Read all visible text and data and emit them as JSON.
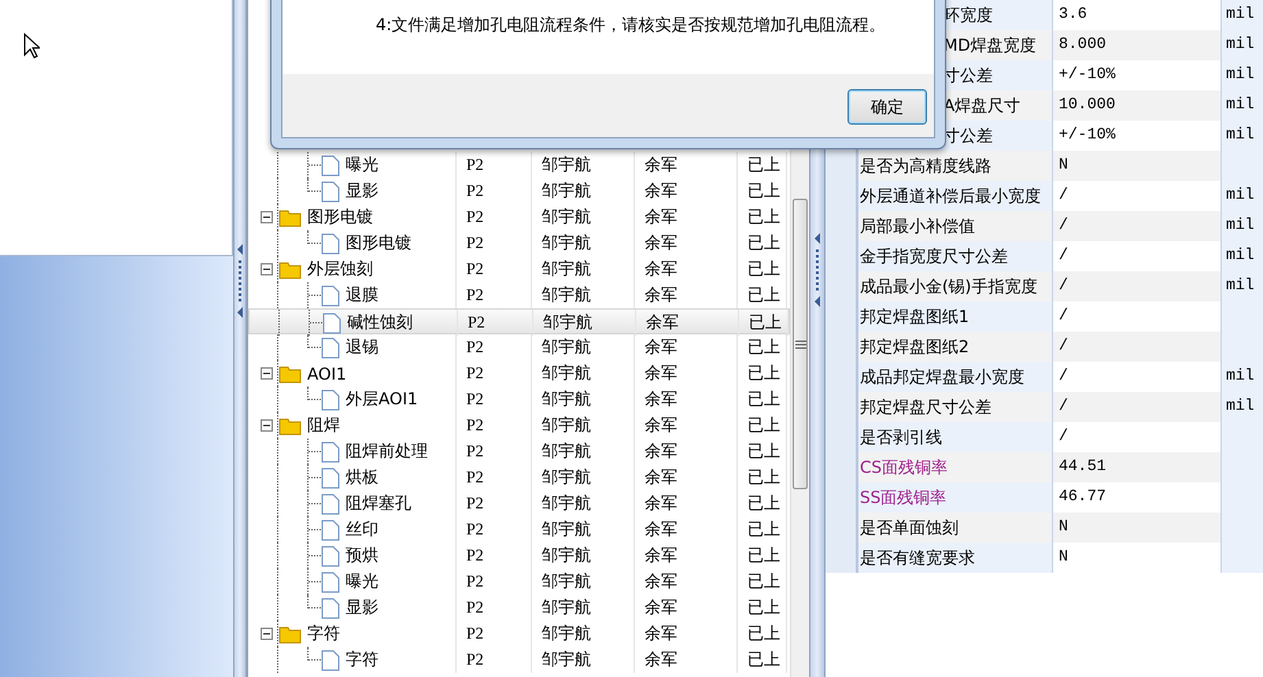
{
  "dialog": {
    "message": "4:文件满足增加孔电阻流程条件，请核实是否按规范增加孔电阻流程。",
    "ok_button": "确定"
  },
  "tree_grid": {
    "rows": [
      {
        "children": [
          {
            "name": "曝光",
            "c2": "P2",
            "c3": "邹宇航",
            "c4": "余军",
            "c5": "已上",
            "selected": false
          },
          {
            "name": "显影",
            "c2": "P2",
            "c3": "邹宇航",
            "c4": "余军",
            "c5": "已上",
            "selected": false
          }
        ]
      },
      {
        "name": "图形电镀",
        "c2": "P2",
        "c3": "邹宇航",
        "c4": "余军",
        "c5": "已上",
        "expanded": true,
        "selected": false,
        "children": [
          {
            "name": "图形电镀",
            "c2": "P2",
            "c3": "邹宇航",
            "c4": "余军",
            "c5": "已上",
            "selected": false
          }
        ]
      },
      {
        "name": "外层蚀刻",
        "c2": "P2",
        "c3": "邹宇航",
        "c4": "余军",
        "c5": "已上",
        "expanded": true,
        "selected": false,
        "children": [
          {
            "name": "退膜",
            "c2": "P2",
            "c3": "邹宇航",
            "c4": "余军",
            "c5": "已上",
            "selected": false
          },
          {
            "name": "碱性蚀刻",
            "c2": "P2",
            "c3": "邹宇航",
            "c4": "余军",
            "c5": "已上",
            "selected": true
          },
          {
            "name": "退锡",
            "c2": "P2",
            "c3": "邹宇航",
            "c4": "余军",
            "c5": "已上",
            "selected": false
          }
        ]
      },
      {
        "name": "AOI1",
        "c2": "P2",
        "c3": "邹宇航",
        "c4": "余军",
        "c5": "已上",
        "expanded": true,
        "selected": false,
        "children": [
          {
            "name": "外层AOI1",
            "c2": "P2",
            "c3": "邹宇航",
            "c4": "余军",
            "c5": "已上",
            "selected": false
          }
        ]
      },
      {
        "name": "阻焊",
        "c2": "P2",
        "c3": "邹宇航",
        "c4": "余军",
        "c5": "已上",
        "expanded": true,
        "selected": false,
        "children": [
          {
            "name": "阻焊前处理",
            "c2": "P2",
            "c3": "邹宇航",
            "c4": "余军",
            "c5": "已上",
            "selected": false
          },
          {
            "name": "烘板",
            "c2": "P2",
            "c3": "邹宇航",
            "c4": "余军",
            "c5": "已上",
            "selected": false
          },
          {
            "name": "阻焊塞孔",
            "c2": "P2",
            "c3": "邹宇航",
            "c4": "余军",
            "c5": "已上",
            "selected": false
          },
          {
            "name": "丝印",
            "c2": "P2",
            "c3": "邹宇航",
            "c4": "余军",
            "c5": "已上",
            "selected": false
          },
          {
            "name": "预烘",
            "c2": "P2",
            "c3": "邹宇航",
            "c4": "余军",
            "c5": "已上",
            "selected": false
          },
          {
            "name": "曝光",
            "c2": "P2",
            "c3": "邹宇航",
            "c4": "余军",
            "c5": "已上",
            "selected": false
          },
          {
            "name": "显影",
            "c2": "P2",
            "c3": "邹宇航",
            "c4": "余军",
            "c5": "已上",
            "selected": false
          }
        ]
      },
      {
        "name": "字符",
        "c2": "P2",
        "c3": "邹宇航",
        "c4": "余军",
        "c5": "已上",
        "expanded": true,
        "selected": false,
        "children": [
          {
            "name": "字符",
            "c2": "P2",
            "c3": "邹宇航",
            "c4": "余军",
            "c5": "已上",
            "selected": false
          }
        ]
      }
    ]
  },
  "property_grid": {
    "rows": [
      {
        "name": "环宽度",
        "value": "3.6",
        "unit": "mil",
        "under_dialog": true
      },
      {
        "name": "MD焊盘宽度",
        "value": "8.000",
        "unit": "mil",
        "under_dialog": true
      },
      {
        "name": "寸公差",
        "value": "+/-10%",
        "unit": "mil",
        "under_dialog": true
      },
      {
        "name": "A焊盘尺寸",
        "value": "10.000",
        "unit": "mil",
        "under_dialog": true
      },
      {
        "name": "寸公差",
        "value": "+/-10%",
        "unit": "mil",
        "under_dialog": true
      },
      {
        "name": "是否为高精度线路",
        "value": "N"
      },
      {
        "name": "外层通道补偿后最小宽度",
        "value": "/",
        "unit": "mil"
      },
      {
        "name": "局部最小补偿值",
        "value": "/",
        "unit": "mil"
      },
      {
        "name": "金手指宽度尺寸公差",
        "value": "/",
        "unit": "mil"
      },
      {
        "name": "成品最小金(锡)手指宽度",
        "value": "/",
        "unit": "mil"
      },
      {
        "name": "邦定焊盘图纸1",
        "value": "/"
      },
      {
        "name": "邦定焊盘图纸2",
        "value": "/"
      },
      {
        "name": "成品邦定焊盘最小宽度",
        "value": "/",
        "unit": "mil"
      },
      {
        "name": "邦定焊盘尺寸公差",
        "value": "/",
        "unit": "mil"
      },
      {
        "name": "是否剥引线",
        "value": "/"
      },
      {
        "name": "CS面残铜率",
        "value": "44.51",
        "color": "#a0208c"
      },
      {
        "name": "SS面残铜率",
        "value": "46.77",
        "color": "#a0208c"
      },
      {
        "name": "是否单面蚀刻",
        "value": "N"
      },
      {
        "name": "是否有缝宽要求",
        "value": "N"
      }
    ]
  }
}
